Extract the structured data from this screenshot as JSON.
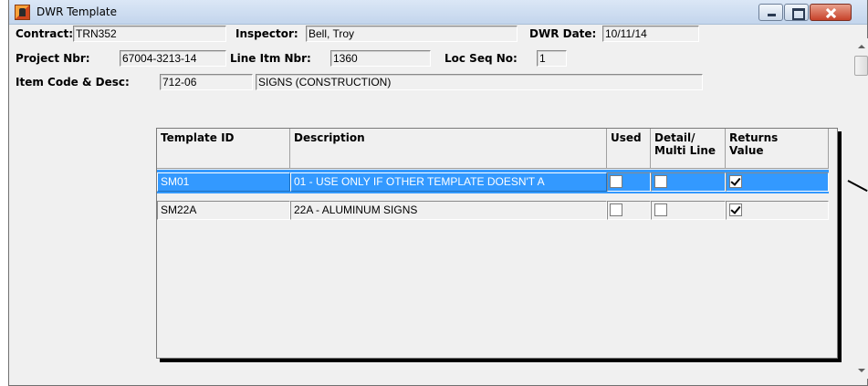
{
  "window": {
    "title": "DWR Template"
  },
  "form": {
    "contract": {
      "label": "Contract:",
      "value": "TRN352"
    },
    "inspector": {
      "label": "Inspector:",
      "value": "Bell, Troy"
    },
    "dwr_date": {
      "label": "DWR Date:",
      "value": "10/11/14"
    },
    "project_nbr": {
      "label": "Project Nbr:",
      "value": "67004-3213-14"
    },
    "line_itm_nbr": {
      "label": "Line Itm Nbr:",
      "value": "1360"
    },
    "loc_seq_no": {
      "label": "Loc Seq No:",
      "value": "1"
    },
    "item_code_desc": {
      "label": "Item Code & Desc:",
      "code": "712-06",
      "desc": "SIGNS (CONSTRUCTION)"
    }
  },
  "grid": {
    "headers": {
      "template_id": "Template ID",
      "description": "Description",
      "used": "Used",
      "detail_multi_1": "Detail/",
      "detail_multi_2": "Multi Line",
      "returns_1": "Returns",
      "returns_2": "Value"
    },
    "rows": [
      {
        "template_id": "SM01",
        "description": "01 - USE ONLY IF OTHER TEMPLATE DOESN'T A",
        "used": false,
        "detail_multi_line": false,
        "returns_value": true,
        "selected": true
      },
      {
        "template_id": "SM22A",
        "description": "22A - ALUMINUM SIGNS",
        "used": false,
        "detail_multi_line": false,
        "returns_value": true,
        "selected": false
      }
    ]
  },
  "icons": {
    "app": "app-icon",
    "minimize": "minimize-icon",
    "maximize": "maximize-icon",
    "close": "close-icon"
  },
  "colors": {
    "selection": "#3399ff",
    "window_bg": "#f0f0f0"
  }
}
